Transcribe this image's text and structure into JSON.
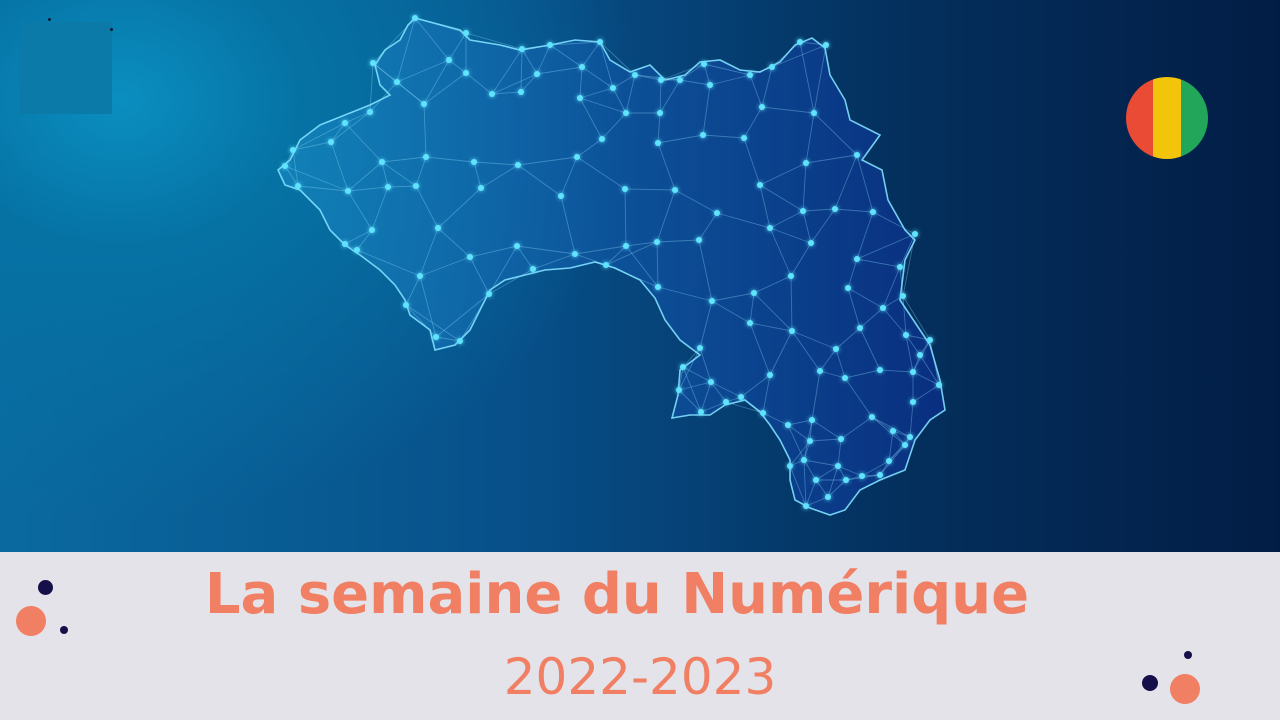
{
  "title": "La semaine du Numérique",
  "year": "2022-2023",
  "colors": {
    "accent_text": "#f07f63",
    "footer_bg": "#e4e3e9",
    "node_color": "#5fe3ff",
    "flag": [
      "#e94b35",
      "#f2c40a",
      "#22a75a"
    ]
  },
  "icons": {
    "map": "guinea-network-map",
    "flag": "guinea-flag-icon",
    "logo": "logo-placeholder"
  }
}
